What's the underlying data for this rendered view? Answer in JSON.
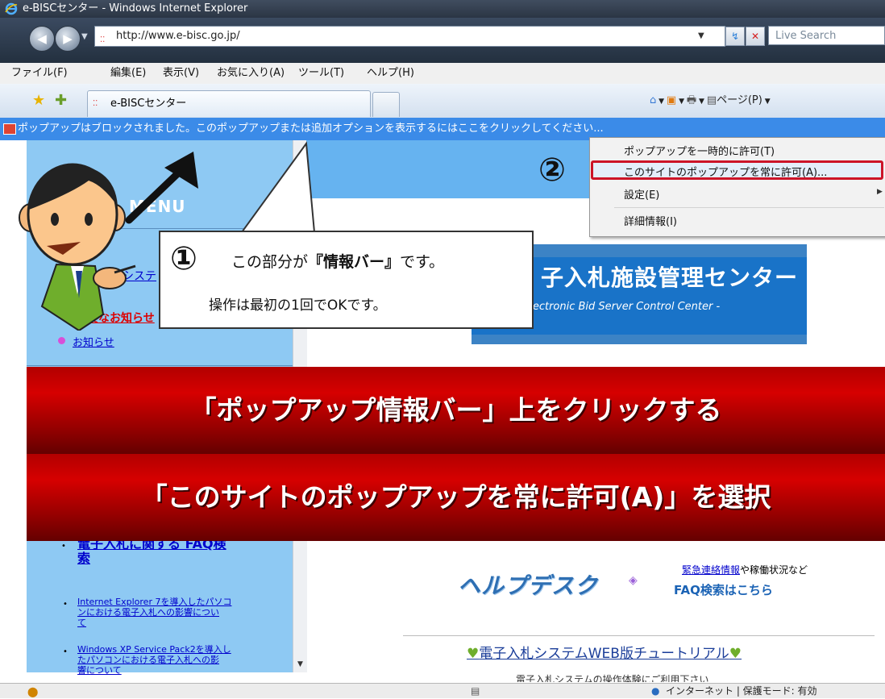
{
  "window": {
    "title": "e-BISCセンター - Windows Internet Explorer"
  },
  "address": {
    "url": "http://www.e-bisc.go.jp/",
    "search_placeholder": "Live Search"
  },
  "menubar": [
    "ファイル(F)",
    "編集(E)",
    "表示(V)",
    "お気に入り(A)",
    "ツール(T)",
    "ヘルプ(H)"
  ],
  "tab": {
    "title": "e-BISCセンター"
  },
  "command_bar": {
    "page_menu": "ページ(P)"
  },
  "infobar": {
    "text": "ポップアップはブロックされました。このポップアップまたは追加オプションを表示するにはここをクリックしてください..."
  },
  "context_menu": {
    "items": [
      "ポップアップを一時的に許可(T)",
      "このサイトのポップアップを常に許可(A)...",
      "設定(E)",
      "詳細情報(I)"
    ]
  },
  "step2": "②",
  "callout": {
    "num": "①",
    "line1_a": "この部分が",
    "line1_b": "『情報バー』",
    "line1_c": "です。",
    "line2": "操作は最初の1回でOKです。"
  },
  "sidebar": {
    "menu_title": "MENU",
    "link1": "電子入札システ",
    "link2": "重要なお知らせ",
    "link3": "お知らせ",
    "faq_link_l1": "電子入札に関する FAQ検",
    "faq_link_l2": "索",
    "ie7_l1": "Internet Explorer 7を導入したパソコ",
    "ie7_l2": "ンにおける電子入札への影響につい",
    "ie7_l3": "て",
    "xp_l1": "Windows XP Service Pack2を導入し",
    "xp_l2": "たパソコンにおける電子入札への影",
    "xp_l3": "響について"
  },
  "banner": {
    "title": "子入札施設管理センター",
    "subtitle": "Electronic Bid Server Control Center -"
  },
  "captions": {
    "line1": "「ポップアップ情報バー」上をクリックする",
    "line2": "「このサイトのポップアップを常に許可(A)」を選択"
  },
  "helpdesk": {
    "title": "ヘルプデスク",
    "emergency_link": "緊急連絡情報",
    "emergency_rest": "や稼働状況など",
    "faq": "FAQ検索はこちら"
  },
  "tutorial": {
    "title": "電子入札システムWEB版チュートリアル",
    "sub": "電子入札システムの操作体験にご利用下さい"
  },
  "status": {
    "zone": "インターネット | 保護モード: 有効"
  }
}
